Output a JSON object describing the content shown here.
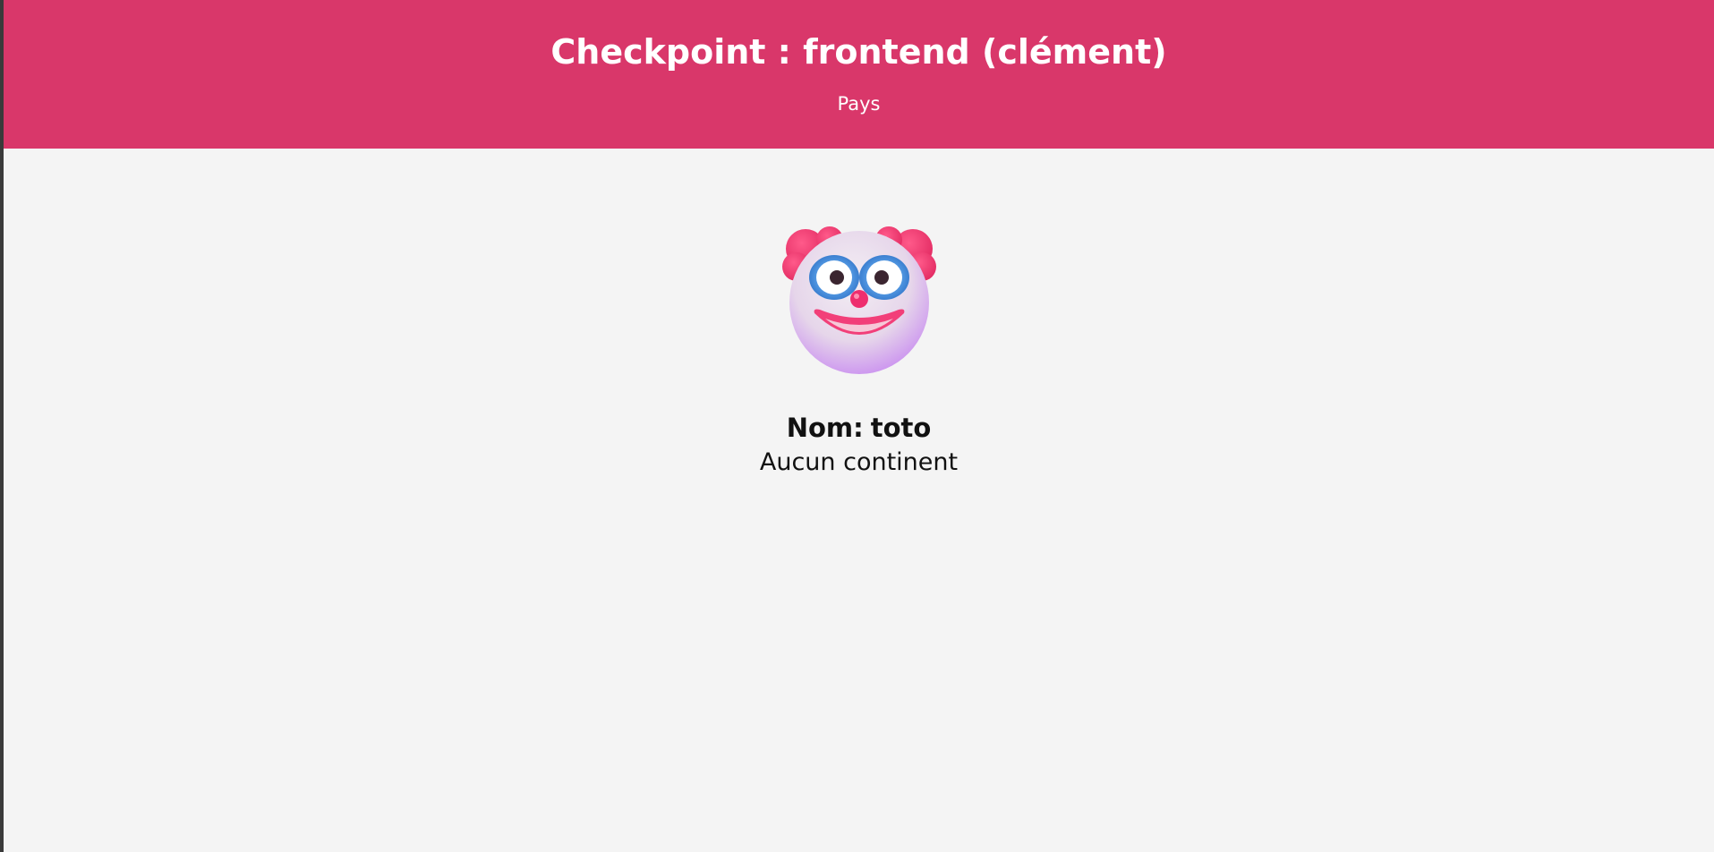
{
  "header": {
    "title": "Checkpoint : frontend (clément)",
    "nav_link": "Pays"
  },
  "profile": {
    "avatar_icon": "clown-face-icon",
    "name_prefix": "Nom:",
    "name": "toto",
    "continent": "Aucun continent"
  },
  "colors": {
    "header_bg": "#d9376a",
    "page_bg": "#f4f4f4",
    "text": "#111111"
  }
}
